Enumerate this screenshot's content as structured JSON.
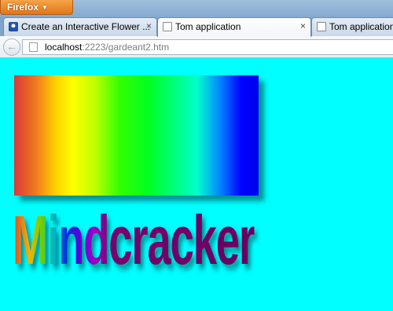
{
  "browser": {
    "menu_button": "Firefox",
    "menu_caret": "▼"
  },
  "tabs": [
    {
      "label": "Create an Interactive Flower ...",
      "close": "×",
      "icon": "flower-icon",
      "active": false
    },
    {
      "label": "Tom application",
      "close": "×",
      "icon": "page-icon",
      "active": true
    },
    {
      "label": "Tom application",
      "close": "",
      "icon": "page-icon",
      "active": false
    }
  ],
  "navbar": {
    "back_glyph": "←",
    "url_host": "localhost",
    "url_rest": ":2223/gardeant2.htm"
  },
  "page": {
    "background": "#00ffff",
    "logo_text": "Mindcracker"
  }
}
